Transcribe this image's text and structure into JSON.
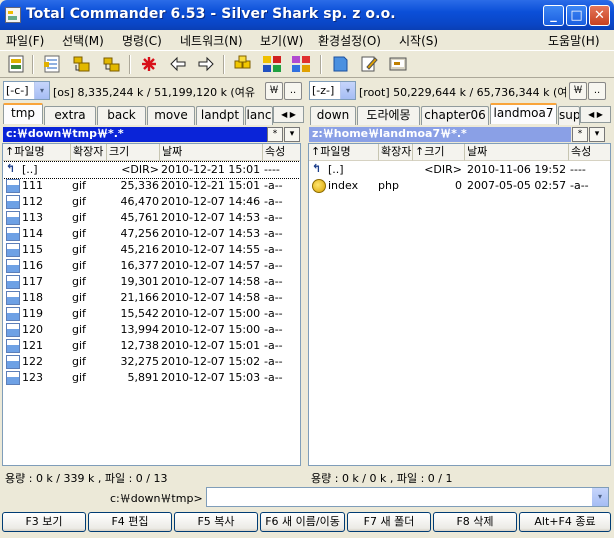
{
  "window": {
    "title": "Total Commander 6.53 - Silver Shark sp. z o.o."
  },
  "menu": {
    "items": [
      {
        "label": "파일(F)"
      },
      {
        "label": "선택(M)"
      },
      {
        "label": "명령(C)"
      },
      {
        "label": "네트워크(N)"
      },
      {
        "label": "보기(W)"
      },
      {
        "label": "환경설정(O)"
      },
      {
        "label": "시작(S)"
      },
      {
        "label": "도움말(H)"
      }
    ]
  },
  "left": {
    "drive": "[-c-]",
    "drive_info": "[os]  8,335,244 k / 51,199,120 k (여유",
    "tabs": [
      {
        "label": "tmp"
      },
      {
        "label": "extra"
      },
      {
        "label": "back"
      },
      {
        "label": "move"
      },
      {
        "label": "landpt"
      },
      {
        "label": "lanc"
      }
    ],
    "path": "c:￦down￦tmp￦*.*",
    "headers": {
      "name": "↑파일명",
      "ext": "확장자",
      "size": "크기",
      "date": "날짜",
      "attr": "속성"
    },
    "files": [
      {
        "name": "[..]",
        "ext": "",
        "size": "<DIR>",
        "date": "2010-12-21 15:01",
        "attr": "----"
      },
      {
        "name": "111",
        "ext": "gif",
        "size": "25,336",
        "date": "2010-12-21 15:01",
        "attr": "-a--"
      },
      {
        "name": "112",
        "ext": "gif",
        "size": "46,470",
        "date": "2010-12-07 14:46",
        "attr": "-a--"
      },
      {
        "name": "113",
        "ext": "gif",
        "size": "45,761",
        "date": "2010-12-07 14:53",
        "attr": "-a--"
      },
      {
        "name": "114",
        "ext": "gif",
        "size": "47,256",
        "date": "2010-12-07 14:53",
        "attr": "-a--"
      },
      {
        "name": "115",
        "ext": "gif",
        "size": "45,216",
        "date": "2010-12-07 14:55",
        "attr": "-a--"
      },
      {
        "name": "116",
        "ext": "gif",
        "size": "16,377",
        "date": "2010-12-07 14:57",
        "attr": "-a--"
      },
      {
        "name": "117",
        "ext": "gif",
        "size": "19,301",
        "date": "2010-12-07 14:58",
        "attr": "-a--"
      },
      {
        "name": "118",
        "ext": "gif",
        "size": "21,166",
        "date": "2010-12-07 14:58",
        "attr": "-a--"
      },
      {
        "name": "119",
        "ext": "gif",
        "size": "15,542",
        "date": "2010-12-07 15:00",
        "attr": "-a--"
      },
      {
        "name": "120",
        "ext": "gif",
        "size": "13,994",
        "date": "2010-12-07 15:00",
        "attr": "-a--"
      },
      {
        "name": "121",
        "ext": "gif",
        "size": "12,738",
        "date": "2010-12-07 15:01",
        "attr": "-a--"
      },
      {
        "name": "122",
        "ext": "gif",
        "size": "32,275",
        "date": "2010-12-07 15:02",
        "attr": "-a--"
      },
      {
        "name": "123",
        "ext": "gif",
        "size": "5,891",
        "date": "2010-12-07 15:03",
        "attr": "-a--"
      }
    ],
    "status": "용량 : 0 k / 339 k , 파일 : 0 / 13"
  },
  "right": {
    "drive": "[-z-]",
    "drive_info": "[root]  50,229,644 k / 65,736,344 k (여",
    "tabs": [
      {
        "label": "down"
      },
      {
        "label": "도라에몽"
      },
      {
        "label": "chapter06"
      },
      {
        "label": "landmoa7"
      },
      {
        "label": "sup"
      }
    ],
    "path": "z:￦home￦landmoa7￦*.*",
    "headers": {
      "name": "↑파일명",
      "ext": "확장자",
      "size": "↑크기",
      "date": "날짜",
      "attr": "속성"
    },
    "files": [
      {
        "name": "[..]",
        "ext": "",
        "size": "<DIR>",
        "date": "2010-11-06 19:52",
        "attr": "----"
      },
      {
        "name": "index",
        "ext": "php",
        "size": "0",
        "date": "2007-05-05 02:57",
        "attr": "-a--"
      }
    ],
    "status": "용량 : 0 k / 0 k , 파일 : 0 / 1"
  },
  "command_line": {
    "label": "c:￦down￦tmp>",
    "value": ""
  },
  "fkeys": [
    {
      "label": "F3 보기"
    },
    {
      "label": "F4 편집"
    },
    {
      "label": "F5 복사"
    },
    {
      "label": "F6 새 이름/이동"
    },
    {
      "label": "F7 새 폴더"
    },
    {
      "label": "F8 삭제"
    },
    {
      "label": "Alt+F4 종료"
    }
  ],
  "misc": {
    "backslash": "￦",
    "dots": "..",
    "star": "*",
    "down": "▾",
    "arrows": "◀ ▶",
    "minimize": "_",
    "maximize": "□",
    "close": "✕"
  },
  "colors": {
    "title": "#0a4fd8",
    "active_path": "#0a24d8",
    "inactive_path": "#8aa0e6"
  }
}
